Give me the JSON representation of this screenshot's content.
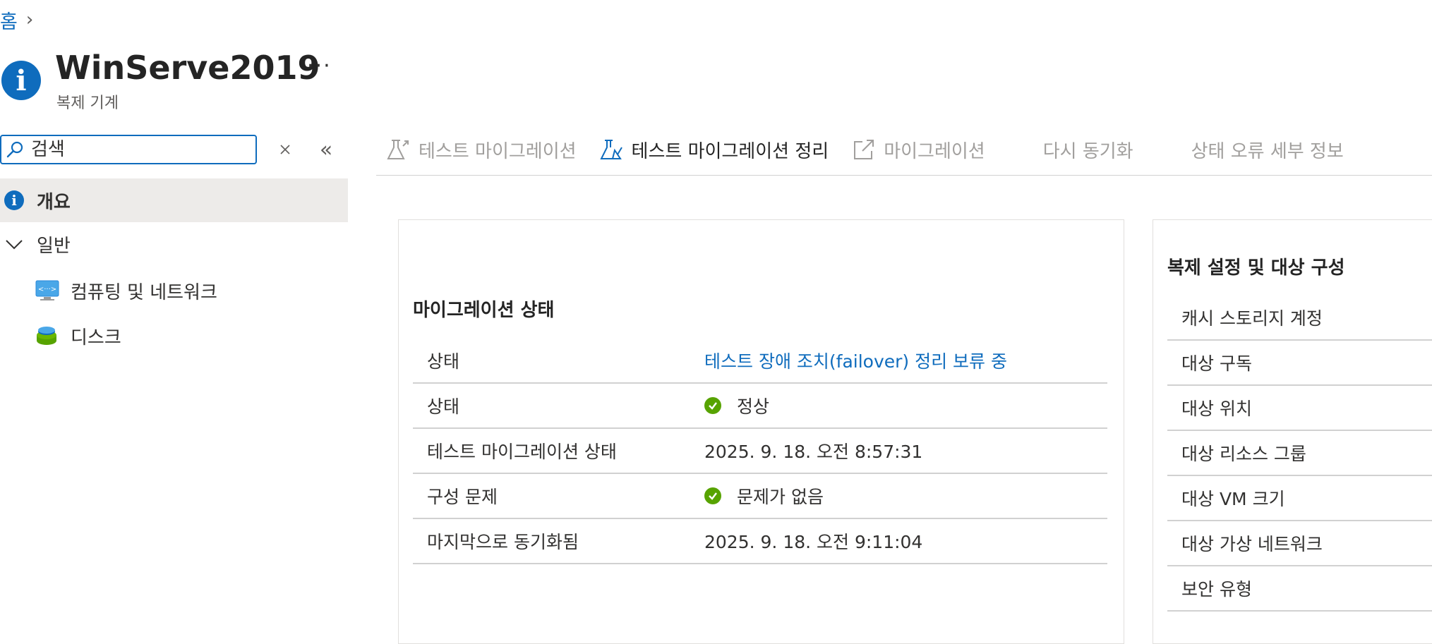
{
  "breadcrumb": {
    "home": "홈",
    "separator": "›"
  },
  "header": {
    "title": "WinServe2019",
    "more": "···",
    "subtitle": "복제 기계"
  },
  "search": {
    "placeholder": "검색",
    "value": ""
  },
  "nav": {
    "overview": "개요",
    "general": "일반",
    "compute": "컴퓨팅 및 네트워크",
    "disks": "디스크"
  },
  "toolbar": {
    "test_migration": "테스트 마이그레이션",
    "cleanup_test_migration": "테스트 마이그레이션 정리",
    "migration": "마이그레이션",
    "resync": "다시 동기화",
    "error_details": "상태 오류 세부 정보"
  },
  "migration_status": {
    "title": "마이그레이션 상태",
    "rows": [
      {
        "key": "상태",
        "value": "테스트 장애 조치(failover) 정리 보류 중"
      },
      {
        "key": "상태",
        "value": "정상"
      },
      {
        "key": "테스트 마이그레이션 상태",
        "value": "2025. 9. 18. 오전 8:57:31"
      },
      {
        "key": "구성 문제",
        "value": "문제가 없음"
      },
      {
        "key": "마지막으로 동기화됨",
        "value": "2025. 9. 18. 오전 9:11:04"
      }
    ]
  },
  "replication_settings": {
    "title": "복제 설정 및 대상 구성",
    "rows": [
      "캐시 스토리지 계정",
      "대상 구독",
      "대상 위치",
      "대상 리소스 그룹",
      "대상 VM 크기",
      "대상 가상 네트워크",
      "보안 유형"
    ]
  },
  "colors": {
    "accent": "#0f6cbd",
    "success": "#57a300",
    "selected_bg": "#edebe9"
  }
}
